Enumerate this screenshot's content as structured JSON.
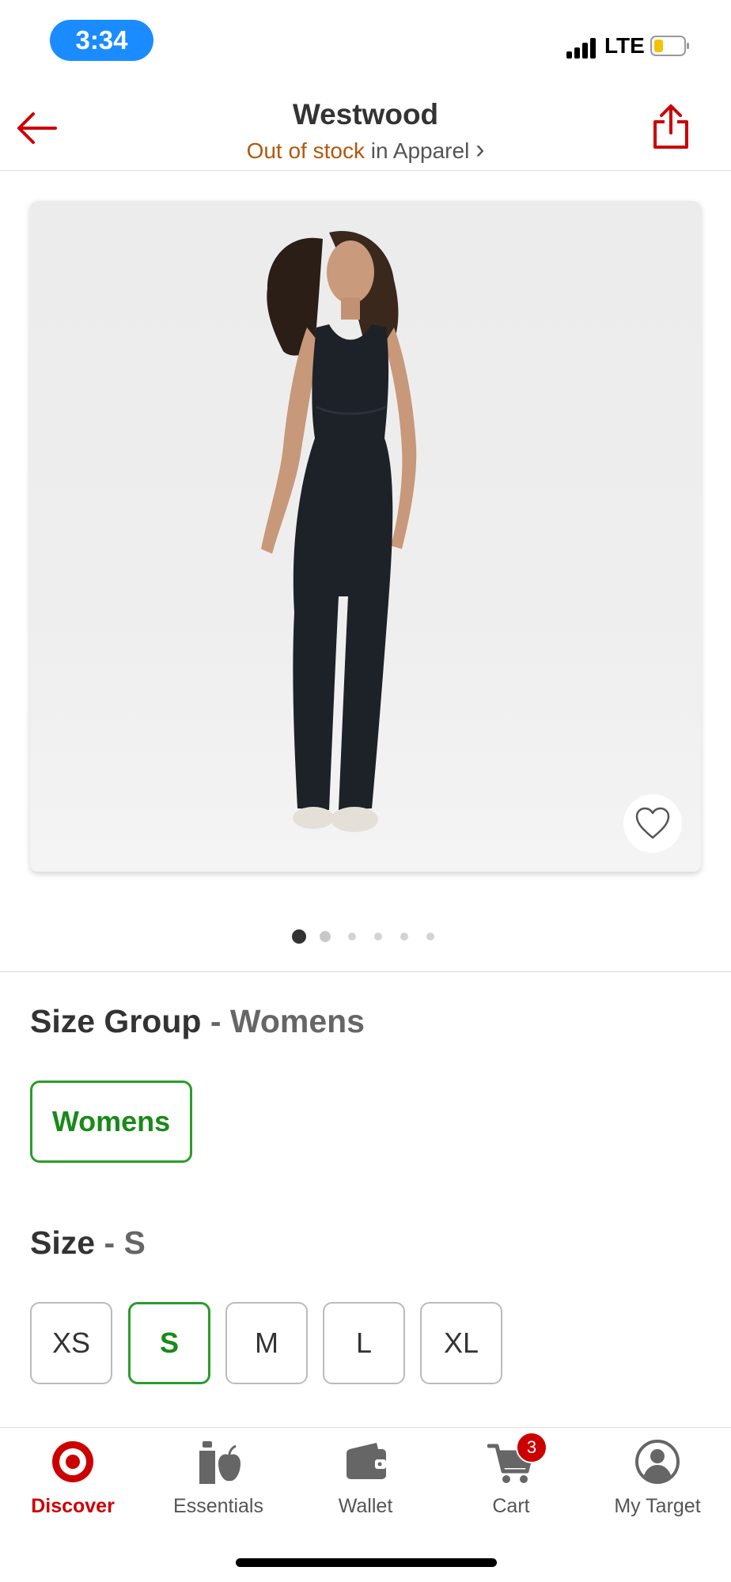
{
  "status": {
    "time": "3:34",
    "network": "LTE"
  },
  "header": {
    "title": "Westwood",
    "stock": "Out of stock",
    "category_prefix": " in Apparel",
    "chevron": "›"
  },
  "gallery": {
    "total_images": 6,
    "current_index": 1
  },
  "size_group": {
    "label": "Size Group",
    "separator": " - ",
    "selected": "Womens",
    "options": [
      "Womens"
    ]
  },
  "size": {
    "label": "Size",
    "separator": " - ",
    "selected": "S",
    "options": [
      "XS",
      "S",
      "M",
      "L",
      "XL"
    ]
  },
  "nav": {
    "items": [
      {
        "label": "Discover",
        "icon": "target-bullseye-icon",
        "active": true
      },
      {
        "label": "Essentials",
        "icon": "essentials-icon"
      },
      {
        "label": "Wallet",
        "icon": "wallet-icon"
      },
      {
        "label": "Cart",
        "icon": "cart-icon",
        "badge": "3"
      },
      {
        "label": "My Target",
        "icon": "profile-icon"
      }
    ]
  },
  "colors": {
    "brand_red": "#cc0000",
    "selected_green": "#198a19",
    "stock_orange": "#b1580e",
    "status_blue": "#1a8cff"
  }
}
